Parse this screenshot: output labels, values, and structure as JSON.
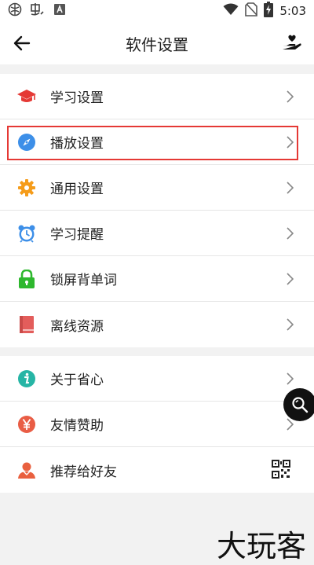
{
  "status_bar": {
    "time": "5:03"
  },
  "app_bar": {
    "title": "软件设置"
  },
  "groups": [
    {
      "items": [
        {
          "label": "学习设置",
          "icon": "graduation-cap-icon",
          "color": "#e53935"
        },
        {
          "label": "播放设置",
          "icon": "compass-icon",
          "color": "#3d8fe8",
          "highlighted": true
        },
        {
          "label": "通用设置",
          "icon": "gear-icon",
          "color": "#f59c1a"
        },
        {
          "label": "学习提醒",
          "icon": "alarm-clock-icon",
          "color": "#3d8fe8"
        },
        {
          "label": "锁屏背单词",
          "icon": "lock-icon",
          "color": "#2eb82e"
        },
        {
          "label": "离线资源",
          "icon": "book-icon",
          "color": "#e35d5b"
        }
      ]
    },
    {
      "items": [
        {
          "label": "关于省心",
          "icon": "info-icon",
          "color": "#26b5a5"
        },
        {
          "label": "友情赞助",
          "icon": "yen-icon",
          "color": "#e95d45"
        },
        {
          "label": "推荐给好友",
          "icon": "person-icon",
          "color": "#e9603f"
        }
      ]
    }
  ],
  "watermark": "大玩客"
}
